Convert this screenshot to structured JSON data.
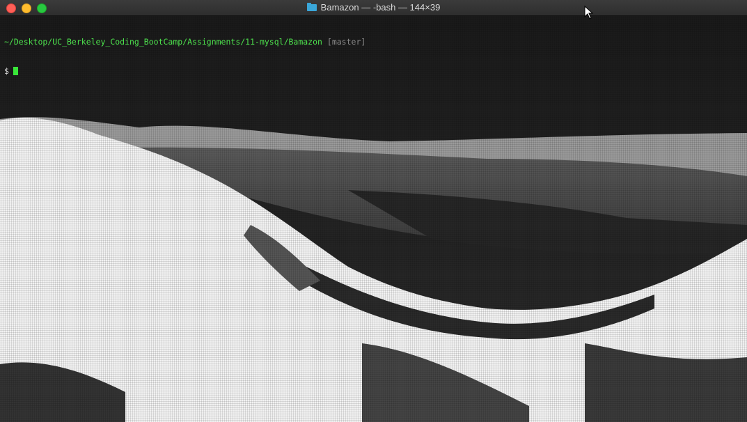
{
  "window": {
    "title": "Bamazon — -bash — 144×39",
    "folder_icon": "folder-icon"
  },
  "terminal": {
    "cwd": "~/Desktop/UC_Berkeley_Coding_BootCamp/Assignments/11-mysql/Bamazon",
    "branch": "[master]",
    "prompt": "$"
  },
  "colors": {
    "path": "#4de24d",
    "branch": "#8a8a8a",
    "cursor": "#39e639",
    "close": "#ff5f57",
    "minimize": "#febc2e",
    "maximize": "#28c840",
    "folder": "#3aa6d8"
  }
}
